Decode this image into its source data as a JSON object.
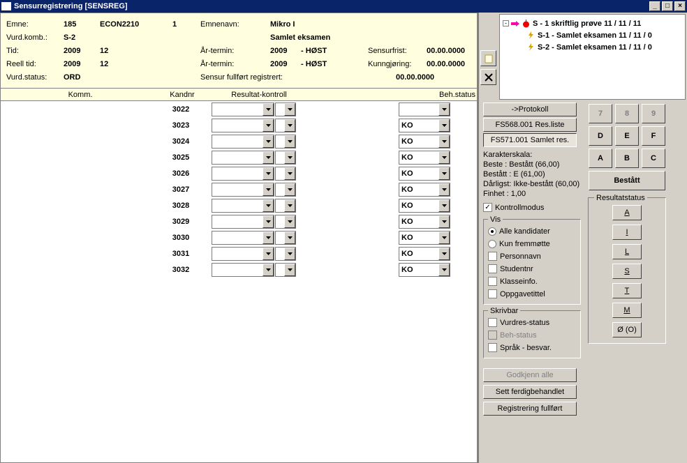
{
  "window": {
    "title": "Sensurregistrering    [SENSREG]",
    "min": "_",
    "max": "▫",
    "close": "×"
  },
  "info": {
    "emne_lbl": "Emne:",
    "emne_num": "185",
    "emne_code": "ECON2210",
    "emne_ver": "1",
    "emnenavn_lbl": "Emnenavn:",
    "emnenavn": "Mikro I",
    "vurdkomb_lbl": "Vurd.komb.:",
    "vurdkomb": "S-2",
    "samlet": "Samlet eksamen",
    "tid_lbl": "Tid:",
    "tid_y": "2009",
    "tid_n": "12",
    "ar_lbl": "År-termin:",
    "ar_y": "2009",
    "ar_t": "-  HØST",
    "sensur_lbl": "Sensurfrist:",
    "sensur": "00.00.0000",
    "reell_lbl": "Reell tid:",
    "reell_y": "2009",
    "reell_n": "12",
    "ar2_y": "2009",
    "ar2_t": "-  HØST",
    "kunn_lbl": "Kunngjøring:",
    "kunn": "00.00.0000",
    "status_lbl": "Vurd.status:",
    "status": "ORD",
    "fullført_lbl": "Sensur fullført registrert:",
    "fullført": "00.00.0000"
  },
  "grid_headers": {
    "komm": "Komm.",
    "kandnr": "Kandnr",
    "resk": "Resultat-kontroll",
    "beh": "Beh.status"
  },
  "rows": [
    {
      "kandnr": "3022",
      "beh": ""
    },
    {
      "kandnr": "3023",
      "beh": "KO"
    },
    {
      "kandnr": "3024",
      "beh": "KO"
    },
    {
      "kandnr": "3025",
      "beh": "KO"
    },
    {
      "kandnr": "3026",
      "beh": "KO"
    },
    {
      "kandnr": "3027",
      "beh": "KO"
    },
    {
      "kandnr": "3028",
      "beh": "KO"
    },
    {
      "kandnr": "3029",
      "beh": "KO"
    },
    {
      "kandnr": "3030",
      "beh": "KO"
    },
    {
      "kandnr": "3031",
      "beh": "KO"
    },
    {
      "kandnr": "3032",
      "beh": "KO"
    }
  ],
  "tree": {
    "n1": "S - 1 skriftlig prøve 11 / 11 / 11",
    "n2": "S-1 - Samlet eksamen 11 / 11 / 0",
    "n3": "S-2 - Samlet eksamen 11 / 11 / 0"
  },
  "buttons": {
    "protokoll": "->Protokoll",
    "fs568": "FS568.001 Res.liste",
    "fs571": "FS571.001 Samlet res.",
    "godkjenn": "Godkjenn alle",
    "sett": "Sett ferdigbehandlet",
    "reg": "Registrering fullført"
  },
  "scale": {
    "title": "Karakterskala:",
    "l1": "Beste   : Bestått (66,00)",
    "l2": "Bestått : E (61,00)",
    "l3": "Dårligst: Ikke-bestått (60,00)",
    "l4": "Finhet  : 1,00"
  },
  "kontroll": "Kontrollmodus",
  "vis": {
    "legend": "Vis",
    "alle": "Alle kandidater",
    "kun": "Kun fremmøtte",
    "person": "Personnavn",
    "student": "Studentnr",
    "klasse": "Klasseinfo.",
    "oppg": "Oppgavetittel"
  },
  "skrivbar": {
    "legend": "Skrivbar",
    "vurd": "Vurdres-status",
    "beh": "Beh-status",
    "sprak": "Språk - besvar."
  },
  "keypad": {
    "k7": "7",
    "k8": "8",
    "k9": "9",
    "kD": "D",
    "kE": "E",
    "kF": "F",
    "kA": "A",
    "kB": "B",
    "kC": "C",
    "best": "Bestått"
  },
  "resultat": {
    "legend": "Resultatstatus",
    "A": "A",
    "I": "I",
    "L": "L",
    "S": "S",
    "T": "T",
    "M": "M",
    "O": "Ø (O)"
  }
}
